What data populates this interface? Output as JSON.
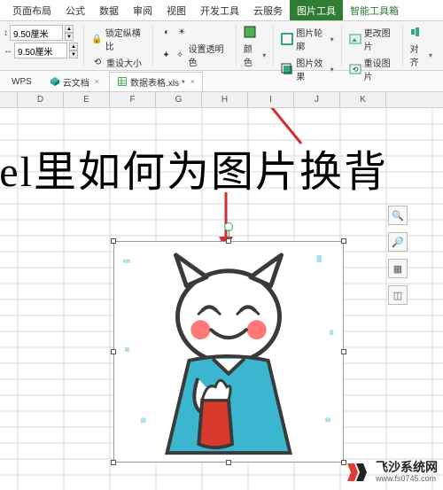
{
  "menubar": {
    "tabs": [
      "页面布局",
      "公式",
      "数据",
      "审阅",
      "视图",
      "开发工具",
      "云服务",
      "图片工具",
      "智能工具箱"
    ],
    "active_index": 7,
    "special_index": 8
  },
  "ribbon": {
    "height_label": "↕",
    "width_label": "↔",
    "height_value": "9.50厘米",
    "width_value": "9.50厘米",
    "lock_ratio": "锁定纵横比",
    "reset_size": "重设大小",
    "adjust_icons": "调整",
    "set_transparent": "设置透明色",
    "color": "颜色",
    "outline": "图片轮廓",
    "effects": "图片效果",
    "change_pic": "更改图片",
    "reset_pic": "重设图片",
    "align": "对齐"
  },
  "doctabs": {
    "wps": "WPS",
    "cloud": "云文档",
    "file": "数据表格.xls *"
  },
  "columns": [
    "",
    "D",
    "E",
    "F",
    "G",
    "H",
    "I",
    "J",
    "K"
  ],
  "overlay_text": "xcel里如何为图片换背",
  "float_buttons": {
    "zoom_in": "+",
    "zoom_out": "−",
    "misc1": "⊞",
    "misc2": "⊡"
  },
  "watermark": {
    "title": "飞沙系统网",
    "url": "www.fs0745.com"
  }
}
